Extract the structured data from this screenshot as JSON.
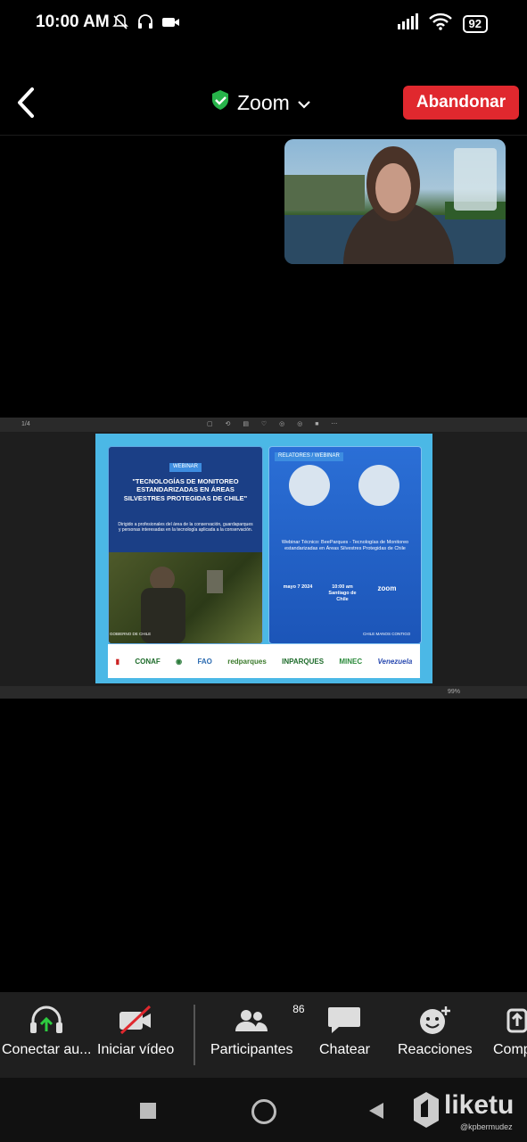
{
  "status_bar": {
    "time": "10:00 AM",
    "battery": "92"
  },
  "header": {
    "app_title": "Zoom",
    "leave_label": "Abandonar"
  },
  "share": {
    "page_indicator": "1/4",
    "zoom_level": "99%",
    "slide": {
      "left_badge": "WEBINAR",
      "left_title": "\"TECNOLOGÍAS DE MONITOREO ESTANDARIZADAS EN ÁREAS SILVESTRES PROTEGIDAS DE CHILE\"",
      "left_desc": "Dirigido a profesionales del área de la conservación, guardaparques y personas interesadas en la tecnología aplicada a la conservación.",
      "right_badge": "RELATORES / WEBINAR",
      "right_title": "Webinar Técnico: BeeParques - Tecnologías de Monitoreo estandarizadas en Áreas Silvestres Protegidas de Chile",
      "date": "mayo 7 2024",
      "time": "10:00 am Santiago de Chile",
      "platform": "zoom",
      "footer_left": "GOBIERNO DE CHILE",
      "footer_right": "CHILE MANOS CONTIGO",
      "logos": [
        "CONAF",
        "FAO",
        "redparques",
        "INPARQUES",
        "MINEC",
        "Venezuela"
      ]
    }
  },
  "toolbar": {
    "audio_label": "Conectar au...",
    "video_label": "Iniciar vídeo",
    "participants_label": "Participantes",
    "participants_count": "86",
    "chat_label": "Chatear",
    "reactions_label": "Reacciones",
    "share_label": "Comp"
  },
  "watermark": {
    "brand": "liketu",
    "handle": "@kpbermudez"
  }
}
